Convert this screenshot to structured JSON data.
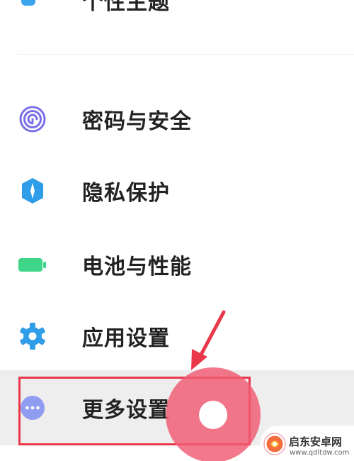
{
  "settings_list": {
    "clipped_top_item": {
      "label": "个性主题",
      "icon": "theme-icon"
    },
    "items": [
      {
        "label": "密码与安全",
        "icon": "fingerprint-icon",
        "icon_color": "#7b6fe8"
      },
      {
        "label": "隐私保护",
        "icon": "privacy-shield-icon",
        "icon_color": "#2f9de8"
      },
      {
        "label": "电池与性能",
        "icon": "battery-icon",
        "icon_color": "#3fd68a"
      },
      {
        "label": "应用设置",
        "icon": "gear-icon",
        "icon_color": "#2f9de8"
      },
      {
        "label": "更多设置",
        "icon": "more-dots-icon",
        "icon_color": "#8f9cf0"
      }
    ]
  },
  "overlay": {
    "highlight_color": "#e8384a",
    "touch_color": "#f05a73"
  },
  "watermark": {
    "name": "启东安卓网",
    "url": "www.qdltdw.com"
  }
}
